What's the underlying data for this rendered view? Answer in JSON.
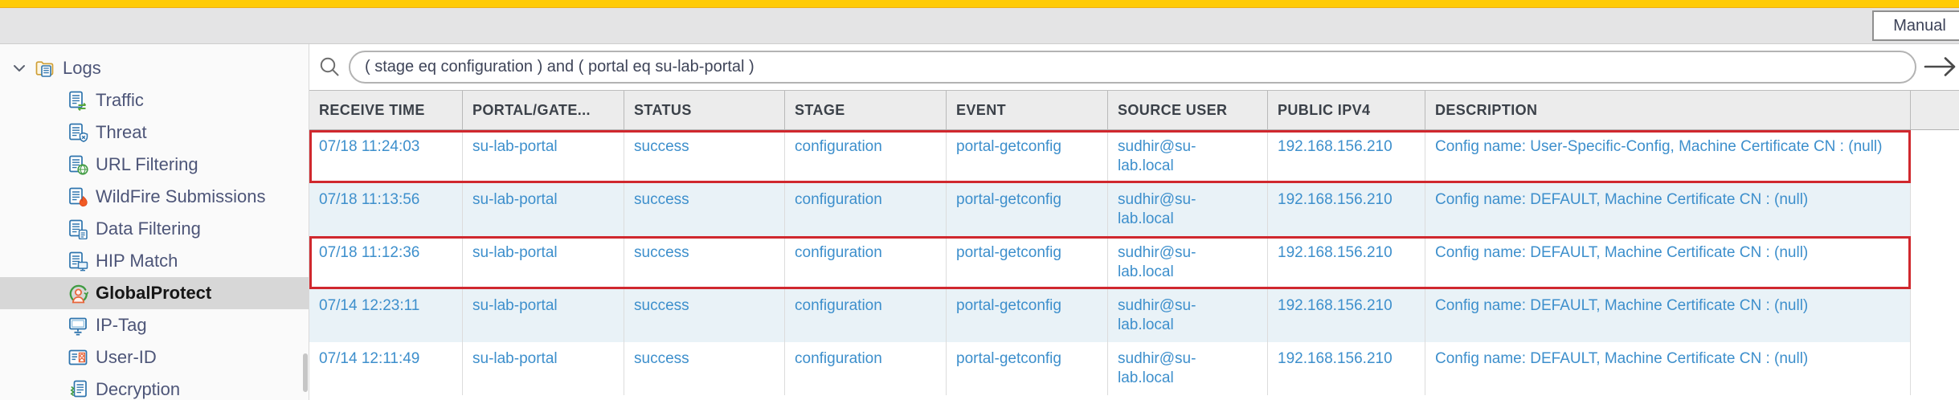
{
  "colors": {
    "accent_yellow": "#ffcb06",
    "highlight_red": "#d0282e",
    "link_blue": "#3d8fcc",
    "row_alt_blue": "#e9f2f7",
    "selected_gray": "#d7d7d7"
  },
  "top_bar": {
    "mode_button": "Manual"
  },
  "sidebar": {
    "root": {
      "label": "Logs",
      "icon": "logs-folder-icon"
    },
    "items": [
      {
        "label": "Traffic",
        "icon": "traffic-log-icon",
        "selected": false
      },
      {
        "label": "Threat",
        "icon": "threat-log-icon",
        "selected": false
      },
      {
        "label": "URL Filtering",
        "icon": "url-filtering-log-icon",
        "selected": false
      },
      {
        "label": "WildFire Submissions",
        "icon": "wildfire-log-icon",
        "selected": false
      },
      {
        "label": "Data Filtering",
        "icon": "data-filtering-log-icon",
        "selected": false
      },
      {
        "label": "HIP Match",
        "icon": "hip-match-log-icon",
        "selected": false
      },
      {
        "label": "GlobalProtect",
        "icon": "globalprotect-log-icon",
        "selected": true
      },
      {
        "label": "IP-Tag",
        "icon": "ip-tag-log-icon",
        "selected": false
      },
      {
        "label": "User-ID",
        "icon": "user-id-log-icon",
        "selected": false
      },
      {
        "label": "Decryption",
        "icon": "decryption-log-icon",
        "selected": false
      }
    ]
  },
  "filter_bar": {
    "query": "( stage eq configuration ) and ( portal eq su-lab-portal )"
  },
  "table": {
    "columns": [
      "RECEIVE TIME",
      "PORTAL/GATE...",
      "STATUS",
      "STAGE",
      "EVENT",
      "SOURCE USER",
      "PUBLIC IPV4",
      "DESCRIPTION"
    ],
    "rows": [
      {
        "receive_time": "07/18 11:24:03",
        "portal": "su-lab-portal",
        "status": "success",
        "stage": "configuration",
        "event": "portal-getconfig",
        "source_user": "sudhir@su-lab.local",
        "public_ipv4": "192.168.156.210",
        "description": "Config name: User-Specific-Config, Machine Certificate CN : (null)",
        "highlighted": true
      },
      {
        "receive_time": "07/18 11:13:56",
        "portal": "su-lab-portal",
        "status": "success",
        "stage": "configuration",
        "event": "portal-getconfig",
        "source_user": "sudhir@su-lab.local",
        "public_ipv4": "192.168.156.210",
        "description": "Config name: DEFAULT, Machine Certificate CN : (null)",
        "highlighted": false
      },
      {
        "receive_time": "07/18 11:12:36",
        "portal": "su-lab-portal",
        "status": "success",
        "stage": "configuration",
        "event": "portal-getconfig",
        "source_user": "sudhir@su-lab.local",
        "public_ipv4": "192.168.156.210",
        "description": "Config name: DEFAULT, Machine Certificate CN : (null)",
        "highlighted": true
      },
      {
        "receive_time": "07/14 12:23:11",
        "portal": "su-lab-portal",
        "status": "success",
        "stage": "configuration",
        "event": "portal-getconfig",
        "source_user": "sudhir@su-lab.local",
        "public_ipv4": "192.168.156.210",
        "description": "Config name: DEFAULT, Machine Certificate CN : (null)",
        "highlighted": false
      },
      {
        "receive_time": "07/14 12:11:49",
        "portal": "su-lab-portal",
        "status": "success",
        "stage": "configuration",
        "event": "portal-getconfig",
        "source_user": "sudhir@su-lab.local",
        "public_ipv4": "192.168.156.210",
        "description": "Config name: DEFAULT, Machine Certificate CN : (null)",
        "highlighted": false
      }
    ]
  }
}
